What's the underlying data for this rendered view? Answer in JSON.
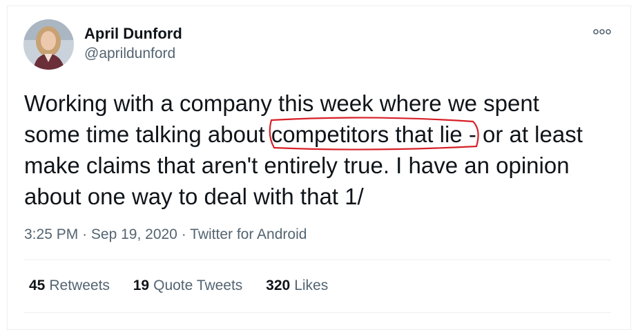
{
  "author": {
    "name": "April Dunford",
    "handle": "@aprildunford"
  },
  "tweet": {
    "text_before": "Working with a company this week where we spent some time talking about ",
    "highlighted": "competitors that lie",
    "text_after": " - or at least make claims that aren't entirely true. I have an opinion about one way to deal with that 1/",
    "highlight_color": "#d72027"
  },
  "meta": {
    "time": "3:25 PM",
    "separator": "·",
    "date": "Sep 19, 2020",
    "source": "Twitter for Android"
  },
  "stats": [
    {
      "count": "45",
      "label": "Retweets"
    },
    {
      "count": "19",
      "label": "Quote Tweets"
    },
    {
      "count": "320",
      "label": "Likes"
    }
  ],
  "icons": {
    "more": "more-options-icon"
  },
  "colors": {
    "text_primary": "#0f1419",
    "text_secondary": "#536471",
    "border": "#ebeef0"
  }
}
